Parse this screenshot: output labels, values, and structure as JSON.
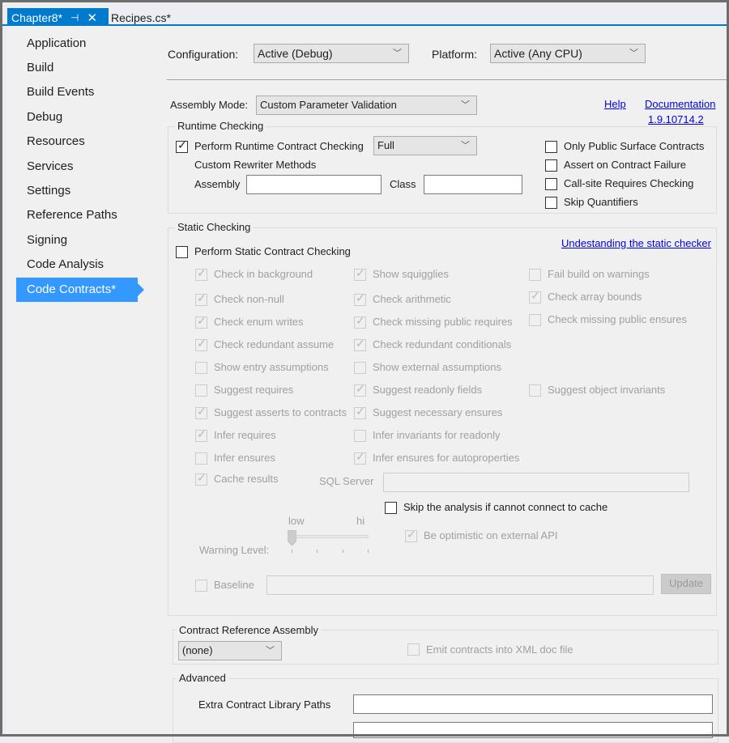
{
  "tabs": {
    "active": {
      "label": "Chapter8*",
      "pin_icon": "pin-icon",
      "close_icon": "close-icon"
    },
    "inactive": {
      "label": "Recipes.cs*"
    }
  },
  "sidebar": {
    "items": [
      {
        "label": "Application"
      },
      {
        "label": "Build"
      },
      {
        "label": "Build Events"
      },
      {
        "label": "Debug"
      },
      {
        "label": "Resources"
      },
      {
        "label": "Services"
      },
      {
        "label": "Settings"
      },
      {
        "label": "Reference Paths"
      },
      {
        "label": "Signing"
      },
      {
        "label": "Code Analysis"
      },
      {
        "label": "Code Contracts*",
        "active": true
      }
    ]
  },
  "header": {
    "configuration_label": "Configuration:",
    "configuration_value": "Active (Debug)",
    "platform_label": "Platform:",
    "platform_value": "Active (Any CPU)"
  },
  "assembly_mode": {
    "label": "Assembly Mode:",
    "value": "Custom Parameter Validation",
    "help_link": "Help",
    "doc_link": "Documentation",
    "version_link": "1.9.10714.2"
  },
  "runtime": {
    "title": "Runtime Checking",
    "perform_label": "Perform Runtime Contract Checking",
    "perform_checked": true,
    "level_value": "Full",
    "rewriter_label": "Custom Rewriter Methods",
    "assembly_label": "Assembly",
    "assembly_value": "",
    "class_label": "Class",
    "class_value": "",
    "options": [
      {
        "label": "Only Public Surface Contracts",
        "checked": false
      },
      {
        "label": "Assert on Contract Failure",
        "checked": false
      },
      {
        "label": "Call-site Requires Checking",
        "checked": false
      },
      {
        "label": "Skip Quantifiers",
        "checked": false
      }
    ]
  },
  "static": {
    "title": "Static Checking",
    "perform_label": "Perform Static Contract Checking",
    "perform_checked": false,
    "link": "Undestanding the static checker",
    "col1": [
      {
        "label": "Check in background",
        "checked": true
      },
      {
        "label": "Check non-null",
        "checked": true
      },
      {
        "label": "Check enum writes",
        "checked": true
      },
      {
        "label": "Check redundant assume",
        "checked": true
      },
      {
        "label": "Show entry assumptions",
        "checked": false
      },
      {
        "label": "Suggest requires",
        "checked": false
      },
      {
        "label": "Suggest asserts to contracts",
        "checked": true
      },
      {
        "label": "Infer requires",
        "checked": true
      },
      {
        "label": "Infer ensures",
        "checked": false
      },
      {
        "label": "Cache results",
        "checked": true
      }
    ],
    "col2": [
      {
        "label": "Show squigglies",
        "checked": true
      },
      {
        "label": "Check arithmetic",
        "checked": true
      },
      {
        "label": "Check missing public requires",
        "checked": true
      },
      {
        "label": "Check redundant conditionals",
        "checked": true
      },
      {
        "label": "Show external assumptions",
        "checked": false
      },
      {
        "label": "Suggest readonly fields",
        "checked": true
      },
      {
        "label": "Suggest necessary ensures",
        "checked": true
      },
      {
        "label": "Infer invariants for readonly",
        "checked": false
      },
      {
        "label": "Infer ensures for autoproperties",
        "checked": true
      }
    ],
    "col3": [
      {
        "label": "Fail build on warnings",
        "checked": false
      },
      {
        "label": "Check array bounds",
        "checked": true
      },
      {
        "label": "Check missing public ensures",
        "checked": false
      },
      {
        "label": "Suggest object invariants",
        "checked": false
      }
    ],
    "sql_server_label": "SQL Server",
    "sql_server_value": "",
    "skip_analysis_label": "Skip the analysis if cannot connect to cache",
    "skip_analysis_checked": false,
    "warning_level_label": "Warning Level:",
    "warning_low": "low",
    "warning_hi": "hi",
    "warning_level_value": 0,
    "warning_level_max": 3,
    "optimistic_label": "Be optimistic on external API",
    "optimistic_checked": true,
    "baseline_label": "Baseline",
    "baseline_checked": false,
    "baseline_value": "",
    "update_button": "Update"
  },
  "contract_reference": {
    "title": "Contract Reference Assembly",
    "value": "(none)",
    "emit_label": "Emit contracts into XML doc file",
    "emit_checked": false
  },
  "advanced": {
    "title": "Advanced",
    "extra_paths_label": "Extra Contract Library Paths",
    "extra_paths_value": ""
  }
}
